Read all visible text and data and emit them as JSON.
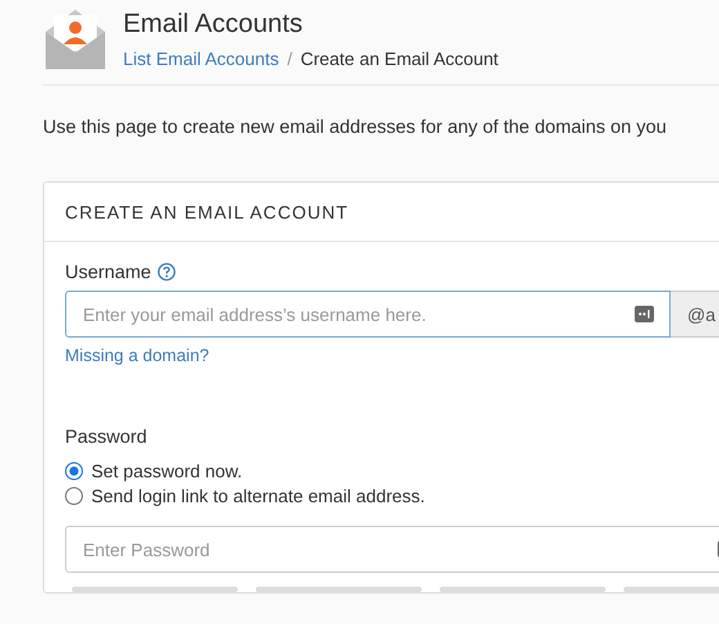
{
  "header": {
    "title": "Email Accounts",
    "breadcrumb": [
      {
        "label": "List Email Accounts",
        "kind": "link"
      },
      {
        "label": "Create an Email Account",
        "kind": "current"
      }
    ],
    "separator": "/"
  },
  "description": "Use this page to create new email addresses for any of the domains on you",
  "card": {
    "title": "CREATE AN EMAIL ACCOUNT",
    "username": {
      "label": "Username",
      "placeholder": "Enter your email address’s username here.",
      "domain": "@a",
      "link": "Missing a domain?"
    },
    "password": {
      "label": "Password",
      "options": [
        {
          "label": "Set password now.",
          "selected": true
        },
        {
          "label": "Send login link to alternate email address.",
          "selected": false
        }
      ],
      "placeholder": "Enter Password",
      "strength": {
        "level": 0
      }
    }
  }
}
